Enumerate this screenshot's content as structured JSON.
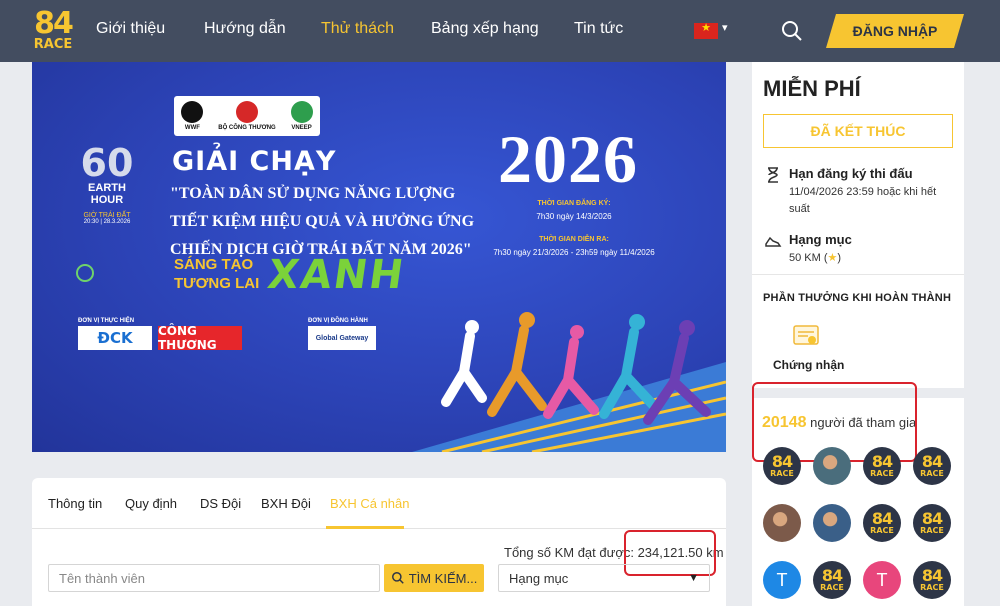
{
  "header": {
    "logo": {
      "num": "84",
      "word": "RACE"
    },
    "nav": [
      "Giới thiệu",
      "Hướng dẫn",
      "Thử thách",
      "Bảng xếp hạng",
      "Tin tức"
    ],
    "active_nav": "Thử thách",
    "login_label": "ĐĂNG NHẬP"
  },
  "banner": {
    "partners": [
      "WWF",
      "BỘ CÔNG THƯƠNG",
      "VNEEP"
    ],
    "earth_hour": {
      "number": "60",
      "title": "EARTH HOUR",
      "vn": "GIỜ TRÁI ĐẤT",
      "date": "20:30 | 28.3.2026"
    },
    "headline": "GIẢI CHẠY",
    "slogan": "\"TOÀN DÂN SỬ DỤNG NĂNG LƯỢNG TIẾT KIỆM HIỆU QUẢ VÀ HƯỞNG ỨNG CHIẾN DỊCH GIỜ TRÁI ĐẤT NĂM 2026\"",
    "tagline_1": "SÁNG TẠO",
    "tagline_2": "TƯƠNG LAI",
    "tagline_big": "XANH",
    "year": "2026",
    "reg_label": "THỜI GIAN ĐĂNG KÝ:",
    "reg_value": "7h30 ngày 14/3/2026",
    "run_label": "THỜI GIAN DIỄN RA:",
    "run_value": "7h30 ngày 21/3/2026 - 23h59 ngày 11/4/2026",
    "org_label": "ĐƠN VỊ THỰC HIỆN",
    "co_label": "ĐƠN VỊ ĐỒNG HÀNH",
    "org_logos": [
      "ĐCK",
      "CÔNG THƯƠNG"
    ],
    "co_logo": "Global Gateway"
  },
  "tabs": [
    "Thông tin",
    "Quy định",
    "DS Đội",
    "BXH Đội",
    "BXH Cá nhân"
  ],
  "active_tab": "BXH Cá nhân",
  "leaderboard": {
    "total_label": "Tổng số KM đạt được:",
    "total_value": "234,121.50 km",
    "member_placeholder": "Tên thành viên",
    "search_label": "TÌM KIẾM...",
    "category_value": "Hạng mục"
  },
  "sidebar": {
    "price": "MIỄN PHÍ",
    "status": "ĐÃ KẾT THÚC",
    "deadline_title": "Hạn đăng ký thi đấu",
    "deadline_value": "11/04/2026 23:59 hoặc khi hết suất",
    "category_title": "Hạng mục",
    "category_value": "50 KM",
    "reward_title": "PHẦN THƯỞNG KHI HOÀN THÀNH",
    "reward_item": "Chứng nhận",
    "participants_count": "20148",
    "participants_label": "người đã tham gia",
    "avatars": [
      {
        "type": "logo"
      },
      {
        "type": "photo"
      },
      {
        "type": "logo"
      },
      {
        "type": "logo"
      },
      {
        "type": "photo"
      },
      {
        "type": "photo"
      },
      {
        "type": "logo"
      },
      {
        "type": "logo"
      },
      {
        "type": "letter",
        "letter": "T",
        "color": "#1e88e5"
      },
      {
        "type": "logo"
      },
      {
        "type": "letter",
        "letter": "T",
        "color": "#e8467c"
      },
      {
        "type": "logo"
      }
    ]
  },
  "colors": {
    "accent": "#f7c531",
    "header": "#434d60",
    "highlight": "#d9232d"
  }
}
